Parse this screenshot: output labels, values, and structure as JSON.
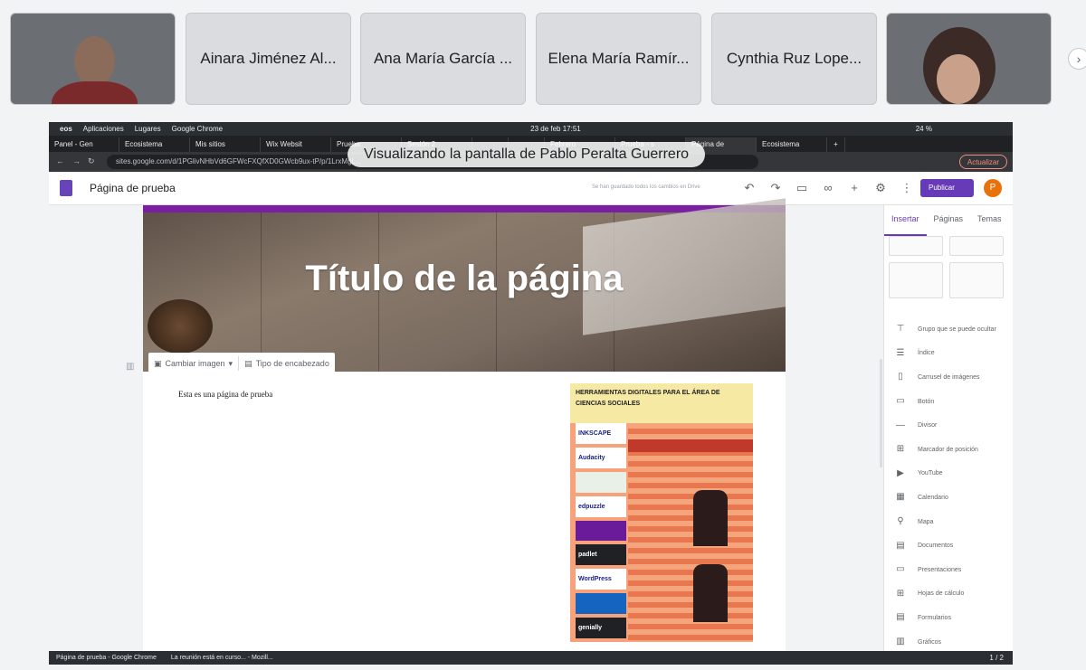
{
  "participants": [
    {
      "name": "",
      "video": true
    },
    {
      "name": "Ainara Jiménez Al..."
    },
    {
      "name": "Ana María García ..."
    },
    {
      "name": "Elena María Ramír..."
    },
    {
      "name": "Cynthia Ruz Lope..."
    },
    {
      "name": "",
      "video": true
    }
  ],
  "os": {
    "menu": [
      "Aplicaciones",
      "Lugares",
      "Google Chrome"
    ],
    "datetime": "23 de feb  17:51",
    "battery": "24 %"
  },
  "browser": {
    "tabs": [
      "Panel - Gen",
      "Ecosistema",
      "Mis sitios",
      "Wix Websit",
      "Prueba",
      "Sesión 2",
      "",
      "",
      "Febrero",
      "Prueba - s",
      "Página de",
      "Ecosistema"
    ],
    "active_tab_index": 10,
    "url": "sites.google.com/d/1PGlivNHbVd6GFWcFXQfXD0GWcb9ux-tP/p/1LrxMgL...",
    "update_label": "Actualizar",
    "share_banner": "Visualizando la pantalla de Pablo Peralta Guerrero"
  },
  "sites": {
    "title": "Página de prueba",
    "saved_status": "Se han guardado todos los cambios en Drive",
    "publish_label": "Publicar",
    "avatar_letter": "P",
    "header_title": "Título de la página",
    "change_image_label": "Cambiar imagen",
    "header_type_label": "Tipo de encabezado",
    "body_text": "Esta es una página de prueba",
    "poster_title": "HERRAMIENTAS DIGITALES PARA EL ÁREA DE CIENCIAS SOCIALES",
    "poster_logos": [
      "INKSCAPE",
      "Audacity",
      "",
      "edpuzzle",
      "",
      "padlet",
      "WordPress",
      "",
      "genially"
    ]
  },
  "sidebar": {
    "tabs": [
      "Insertar",
      "Páginas",
      "Temas"
    ],
    "items": [
      {
        "label": "Grupo que se puede ocultar",
        "icon": "collapsible-icon"
      },
      {
        "label": "Índice",
        "icon": "toc-icon"
      },
      {
        "label": "Carrusel de imágenes",
        "icon": "carousel-icon"
      },
      {
        "label": "Botón",
        "icon": "button-icon"
      },
      {
        "label": "Divisor",
        "icon": "divider-icon"
      },
      {
        "label": "Marcador de posición",
        "icon": "placeholder-icon"
      },
      {
        "label": "YouTube",
        "icon": "youtube-icon"
      },
      {
        "label": "Calendario",
        "icon": "calendar-icon"
      },
      {
        "label": "Mapa",
        "icon": "map-icon"
      },
      {
        "label": "Documentos",
        "icon": "docs-icon"
      },
      {
        "label": "Presentaciones",
        "icon": "slides-icon"
      },
      {
        "label": "Hojas de cálculo",
        "icon": "sheets-icon"
      },
      {
        "label": "Formularios",
        "icon": "forms-icon"
      },
      {
        "label": "Gráficos",
        "icon": "charts-icon"
      }
    ]
  },
  "taskbar": {
    "tasks": [
      "Página de prueba - Google Chrome",
      "La reunión está en curso... - Mozill..."
    ],
    "page": "1 / 2"
  }
}
